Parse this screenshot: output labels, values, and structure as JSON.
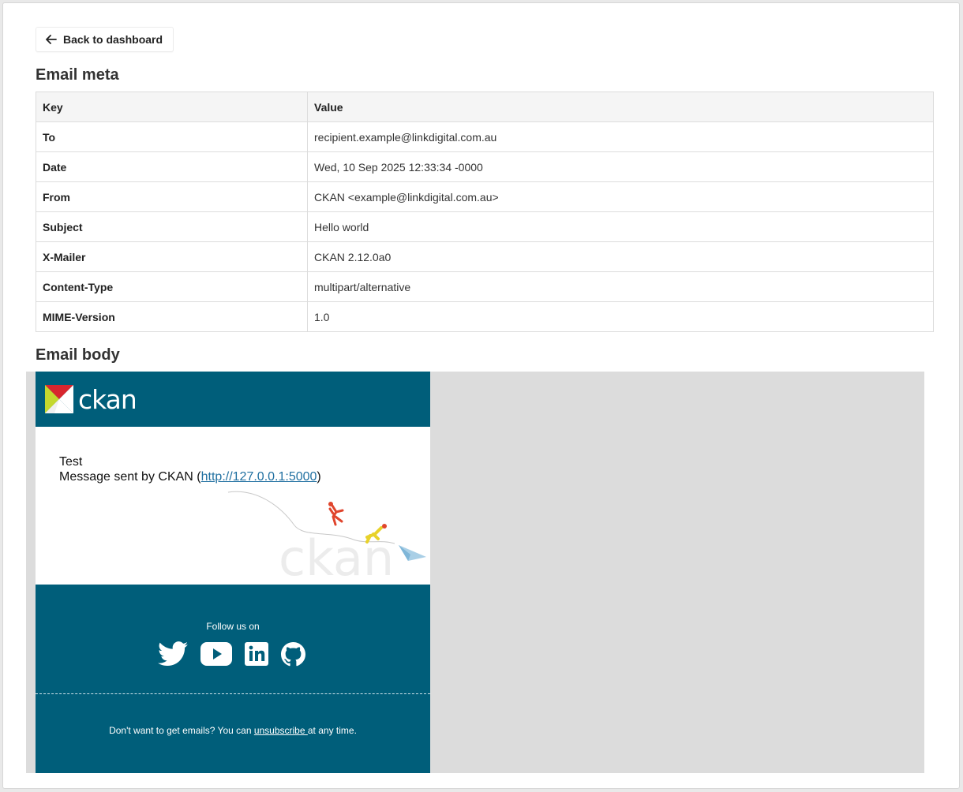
{
  "nav": {
    "back_label": "Back to dashboard"
  },
  "meta_section": {
    "title": "Email meta",
    "columns": [
      "Key",
      "Value"
    ],
    "rows": [
      [
        "To",
        "recipient.example@linkdigital.com.au"
      ],
      [
        "Date",
        "Wed, 10 Sep 2025 12:33:34 -0000"
      ],
      [
        "From",
        "CKAN <example@linkdigital.com.au>"
      ],
      [
        "Subject",
        "Hello world"
      ],
      [
        "X-Mailer",
        "CKAN 2.12.0a0"
      ],
      [
        "Content-Type",
        "multipart/alternative"
      ],
      [
        "MIME-Version",
        "1.0"
      ]
    ]
  },
  "body_section": {
    "title": "Email body"
  },
  "email": {
    "logo_text": "ckan",
    "message_line1": "Test",
    "message_prefix": "Message sent by CKAN (",
    "message_link": "http://127.0.0.1:5000",
    "message_suffix": ")",
    "watermark": "ckan",
    "follow_label": "Follow us on",
    "social": [
      "twitter-icon",
      "youtube-icon",
      "linkedin-icon",
      "github-icon"
    ],
    "unsub_prefix": "Don't want to get emails? You can ",
    "unsub_link": "unsubscribe ",
    "unsub_suffix": "at any time."
  },
  "colors": {
    "brand": "#005e7a",
    "preview_bg": "#dcdcdc",
    "link": "#1f6fa0"
  }
}
